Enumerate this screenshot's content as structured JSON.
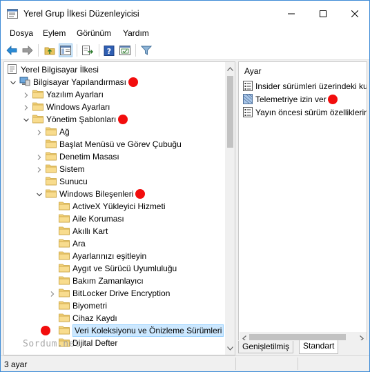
{
  "window": {
    "title": "Yerel Grup İlkesi Düzenleyicisi"
  },
  "menu": [
    "Dosya",
    "Eylem",
    "Görünüm",
    "Yardım"
  ],
  "tree": {
    "root": "Yerel Bilgisayar İlkesi",
    "items": [
      {
        "label": "Bilgisayar Yapılandırması",
        "marked": true
      },
      {
        "label": "Yazılım Ayarları",
        "marked": false
      },
      {
        "label": "Windows Ayarları",
        "marked": false
      },
      {
        "label": "Yönetim Şablonları",
        "marked": true
      },
      {
        "label": "Ağ",
        "marked": false
      },
      {
        "label": "Başlat Menüsü ve Görev Çubuğu",
        "marked": false
      },
      {
        "label": "Denetim Masası",
        "marked": false
      },
      {
        "label": "Sistem",
        "marked": false
      },
      {
        "label": "Sunucu",
        "marked": false
      },
      {
        "label": "Windows Bileşenleri",
        "marked": true
      },
      {
        "label": "ActiveX Yükleyici Hizmeti",
        "marked": false
      },
      {
        "label": "Aile Koruması",
        "marked": false
      },
      {
        "label": "Akıllı Kart",
        "marked": false
      },
      {
        "label": "Ara",
        "marked": false
      },
      {
        "label": "Ayarlarınızı eşitleyin",
        "marked": false
      },
      {
        "label": "Aygıt ve Sürücü Uyumluluğu",
        "marked": false
      },
      {
        "label": "Bakım Zamanlayıcı",
        "marked": false
      },
      {
        "label": "BitLocker Drive Encryption",
        "marked": false
      },
      {
        "label": "Biyometri",
        "marked": false
      },
      {
        "label": "Cihaz Kaydı",
        "marked": false
      },
      {
        "label": "Veri Koleksiyonu ve Önizleme Sürümleri",
        "marked": true
      },
      {
        "label": "Dijital Defter",
        "marked": false
      }
    ]
  },
  "right": {
    "header": "Ayar",
    "items": [
      {
        "label": "Insider sürümleri üzerindeki ku",
        "marked": false
      },
      {
        "label": "Telemetriye izin ver",
        "marked": true
      },
      {
        "label": "Yayın öncesi sürüm özelliklerin",
        "marked": false
      }
    ]
  },
  "tabs": [
    "Genişletilmiş",
    "Standart"
  ],
  "status": "3 ayar",
  "watermark": "Sordum.net",
  "colors": {
    "marker": "#f20d0d",
    "accent": "#3c8ad6",
    "folder": "#f3d27a",
    "selection": "#cce8ff"
  }
}
